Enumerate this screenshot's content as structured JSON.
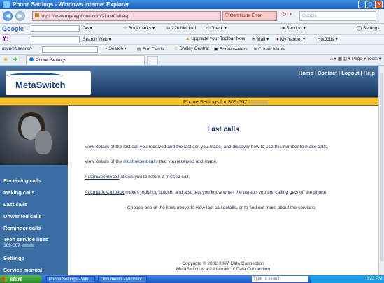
{
  "window": {
    "title": "Phone Settings - Windows Internet Explorer"
  },
  "address_bar": {
    "url": "https://www.myexyphone.com/2LastCall.asp",
    "cert_error": "Certificate Error",
    "search_placeholder": "Google"
  },
  "toolbar1": {
    "google": "Google",
    "go": "Go",
    "bookmarks": "Bookmarks",
    "blocked": "226 blocked",
    "check": "Check",
    "send_to": "Send to",
    "settings": "Settings"
  },
  "toolbar2": {
    "search_web": "Search Web",
    "upgrade": "Upgrade your Toolbar Now!",
    "mail": "Mail",
    "my_yahoo": "My Yahoo!",
    "hotjobs": "HotJobs"
  },
  "toolbar3": {
    "mywebsearch": "mywebsearch",
    "search": "Search",
    "fun_cards": "Fun Cards",
    "smiley_central": "Smiley Central",
    "screensavers": "Screensavers",
    "cursor_mania": "Cursor Mania"
  },
  "tabs": {
    "active_tab": "Phone Settings",
    "page_menu": "Page",
    "tools_menu": "Tools"
  },
  "site": {
    "logo": "MetaSwitch",
    "top_links": "Home | Contact | Logout | Help",
    "banner": "Phone Settings for 309-667"
  },
  "sidebar": {
    "items": [
      {
        "label": "Receiving calls"
      },
      {
        "label": "Making calls"
      },
      {
        "label": "Last calls"
      },
      {
        "label": "Unwanted calls"
      },
      {
        "label": "Reminder calls"
      },
      {
        "label": "Teen service lines",
        "sub": "309-667"
      },
      {
        "label": "Settings"
      },
      {
        "label": "Service manual"
      }
    ]
  },
  "main": {
    "title": "Last calls",
    "p1": "View details of the last call you received and the last call you made, and discover how to use this number to make calls.",
    "p2_before": "View details of the ",
    "p2_link": "most recent calls",
    "p2_after": " that you received and made.",
    "p3_link": "Automatic Recall",
    "p3_after": " allows you to return a missed call.",
    "p4_link": "Automatic Callback",
    "p4_after": " makes redialing quicker and also lets you know when the person you are calling gets off the phone.",
    "p5": "Choose one of the links above to view last call details, or to find out more about the services.",
    "footer1": "Copyright © 2002-2007 Data Connection",
    "footer2": "MetaSwitch is a trademark of Data Connection"
  },
  "taskbar": {
    "start": "start",
    "task1": "Phone Settings - Win...",
    "task2": "Document1 - Microsof...",
    "search": "Type to search",
    "clock": "6:23 PM"
  }
}
